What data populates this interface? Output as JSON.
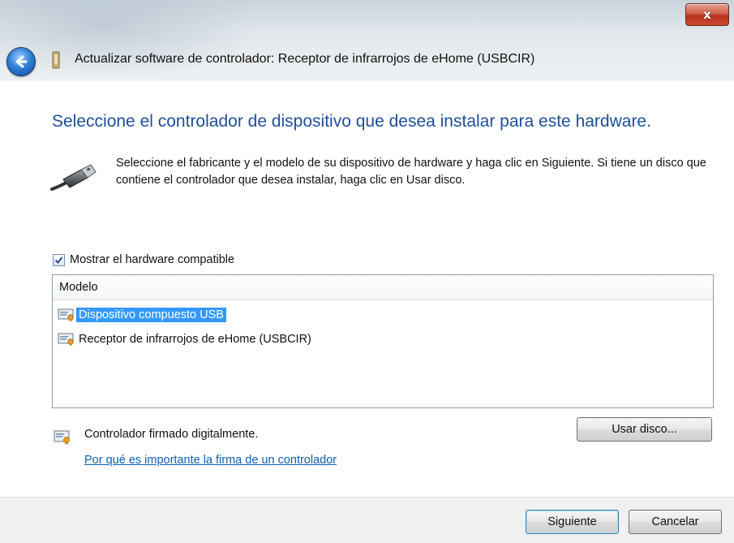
{
  "window": {
    "title": "Actualizar software de controlador: Receptor de infrarrojos de eHome (USBCIR)",
    "close_glyph": "x"
  },
  "main": {
    "heading": "Seleccione el controlador de dispositivo que desea instalar para este hardware.",
    "description": "Seleccione el fabricante y el modelo de su dispositivo de hardware y haga clic en Siguiente. Si tiene un disco que contiene el controlador que desea instalar, haga clic en  Usar disco.",
    "compatible_checkbox": {
      "label": "Mostrar el hardware compatible",
      "checked": true
    },
    "model_list": {
      "header": "Modelo",
      "items": [
        {
          "label": "Dispositivo compuesto USB",
          "selected": true
        },
        {
          "label": "Receptor de infrarrojos de eHome (USBCIR)",
          "selected": false
        }
      ]
    },
    "signed_text": "Controlador firmado digitalmente.",
    "signature_link": "Por qué es importante la firma de un controlador",
    "have_disk_button": "Usar disco..."
  },
  "footer": {
    "next_button": "Siguiente",
    "cancel_button": "Cancelar"
  },
  "icons": {
    "back": "back-arrow-icon",
    "device": "device-icon",
    "usb": "usb-plug-icon",
    "certificate": "certificate-icon"
  },
  "colors": {
    "heading": "#1e4f9b",
    "link": "#0d5fb3",
    "selection": "#3399ff",
    "close_button": "#c94a30"
  }
}
